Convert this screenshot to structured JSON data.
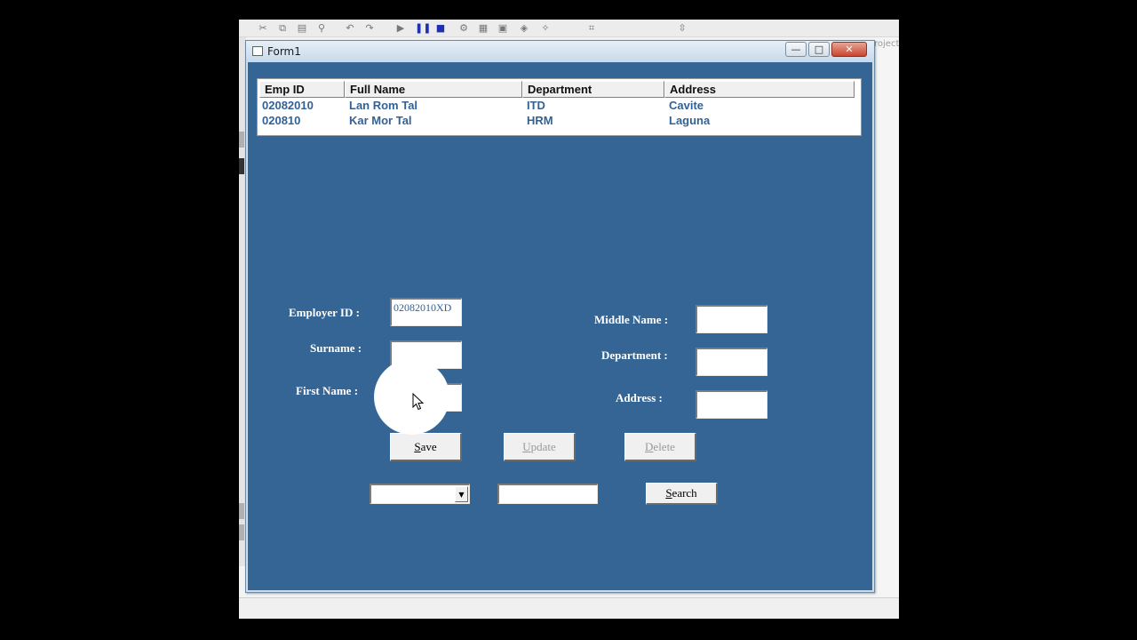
{
  "window": {
    "title": "Form1",
    "minimize_glyph": "—",
    "maximize_glyph": "□",
    "close_glyph": "✕"
  },
  "ide": {
    "right_panel_label": "roject"
  },
  "grid": {
    "columns": [
      "Emp ID",
      "Full Name",
      "Department",
      "Address"
    ],
    "rows": [
      [
        "02082010",
        "Lan Rom Tal",
        "ITD",
        "Cavite"
      ],
      [
        "020810",
        "Kar Mor Tal",
        "HRM",
        "Laguna"
      ]
    ]
  },
  "form": {
    "employer_id_label": "Employer ID :",
    "employer_id_value": "02082010XD",
    "surname_label": "Surname :",
    "surname_value": "",
    "first_name_label": "First Name :",
    "first_name_value": "",
    "middle_name_label": "Middle Name :",
    "middle_name_value": "",
    "department_label": "Department :",
    "department_value": "",
    "address_label": "Address :",
    "address_value": ""
  },
  "buttons": {
    "save": {
      "hotkey": "S",
      "rest": "ave"
    },
    "update": {
      "hotkey": "U",
      "rest": "pdate"
    },
    "delete": {
      "hotkey": "D",
      "rest": "elete"
    },
    "search": {
      "hotkey": "S",
      "rest": "earch"
    }
  },
  "search": {
    "combo_value": "",
    "combo_arrow_glyph": "▼",
    "text_value": ""
  },
  "colors": {
    "form_background": "#356594",
    "grid_text": "#346194",
    "label_text": "#ffffff"
  },
  "icons": {
    "toolbar": [
      "cut-icon",
      "copy-icon",
      "paste-icon",
      "find-icon",
      "undo-icon",
      "redo-icon",
      "run-icon",
      "pause-icon",
      "stop-icon",
      "project-explorer-icon",
      "properties-icon",
      "form-layout-icon",
      "object-browser-icon",
      "toolbox-icon",
      "position-icon",
      "size-icon"
    ]
  }
}
